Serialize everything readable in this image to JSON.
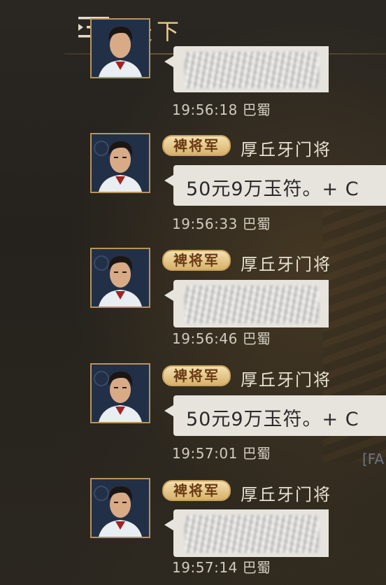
{
  "header": {
    "title": "天下",
    "menu_icon": "list-menu-icon"
  },
  "messages": [
    {
      "rank": "",
      "sender": "",
      "text": "",
      "redacted": true,
      "time": "19:56:18",
      "server": "巴蜀"
    },
    {
      "rank": "裨将军",
      "sender": "厚丘牙门将",
      "text": "50元9万玉符。+ C",
      "redacted": false,
      "time": "19:56:33",
      "server": "巴蜀"
    },
    {
      "rank": "裨将军",
      "sender": "厚丘牙门将",
      "text": "",
      "redacted": true,
      "time": "19:56:46",
      "server": "巴蜀"
    },
    {
      "rank": "裨将军",
      "sender": "厚丘牙门将",
      "text": "50元9万玉符。+ C",
      "redacted": false,
      "time": "19:57:01",
      "server": "巴蜀"
    },
    {
      "rank": "裨将军",
      "sender": "厚丘牙门将",
      "text": "",
      "redacted": true,
      "time": "19:57:14",
      "server": "巴蜀"
    }
  ],
  "background_label": "[FA",
  "colors": {
    "title": "#e9c98b",
    "badge": "#d7b26c",
    "bubble": "#e7e4dd",
    "time": "#d0cbbf"
  }
}
